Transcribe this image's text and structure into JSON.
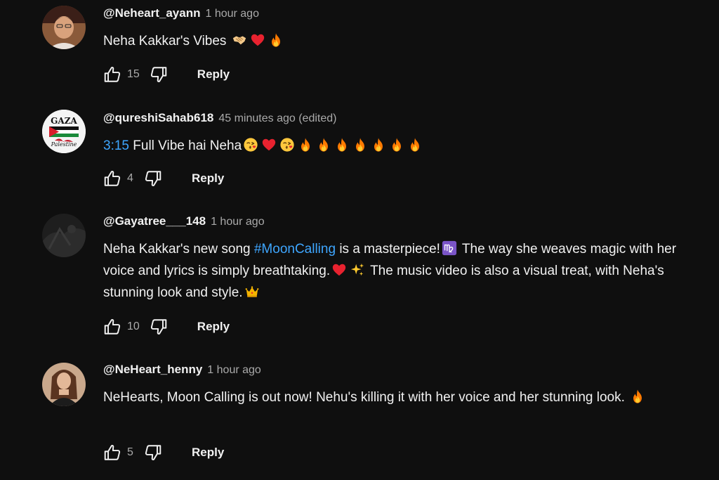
{
  "comments": [
    {
      "author": "@Neheart_ayann",
      "time": "1 hour ago",
      "text": "Neha Kakkar's Vibes",
      "likes": "15",
      "reply_label": "Reply"
    },
    {
      "author": "@qureshiSahab618",
      "time": "45 minutes ago (edited)",
      "timestamp_link": "3:15",
      "text": "Full Vibe hai Neha",
      "likes": "4",
      "reply_label": "Reply",
      "avatar_text": [
        "GAZA",
        "Palestine"
      ]
    },
    {
      "author": "@Gayatree___148",
      "time": "1 hour ago",
      "text_part1": "Neha Kakkar's new song",
      "hashtag": "#MoonCalling",
      "text_part2": "is a masterpiece!",
      "text_part3": "The way she weaves magic with her voice and lyrics is simply breathtaking.",
      "text_part4": "The music video is also a visual treat, with Neha's stunning look and style.",
      "likes": "10",
      "reply_label": "Reply"
    },
    {
      "author": "@NeHeart_henny",
      "time": "1 hour ago",
      "text": "NeHearts, Moon Calling is out now! Nehu's killing it with her voice and her stunning look.",
      "likes": "5",
      "reply_label": "Reply"
    }
  ],
  "icons": {
    "like": "thumbs-up-icon",
    "dislike": "thumbs-down-icon"
  },
  "colors": {
    "background": "#0f0f0f",
    "text": "#f1f1f1",
    "secondary": "#aaaaaa",
    "link": "#3ea6ff",
    "heart": "#e8222f",
    "fire": "#ff7a00"
  }
}
